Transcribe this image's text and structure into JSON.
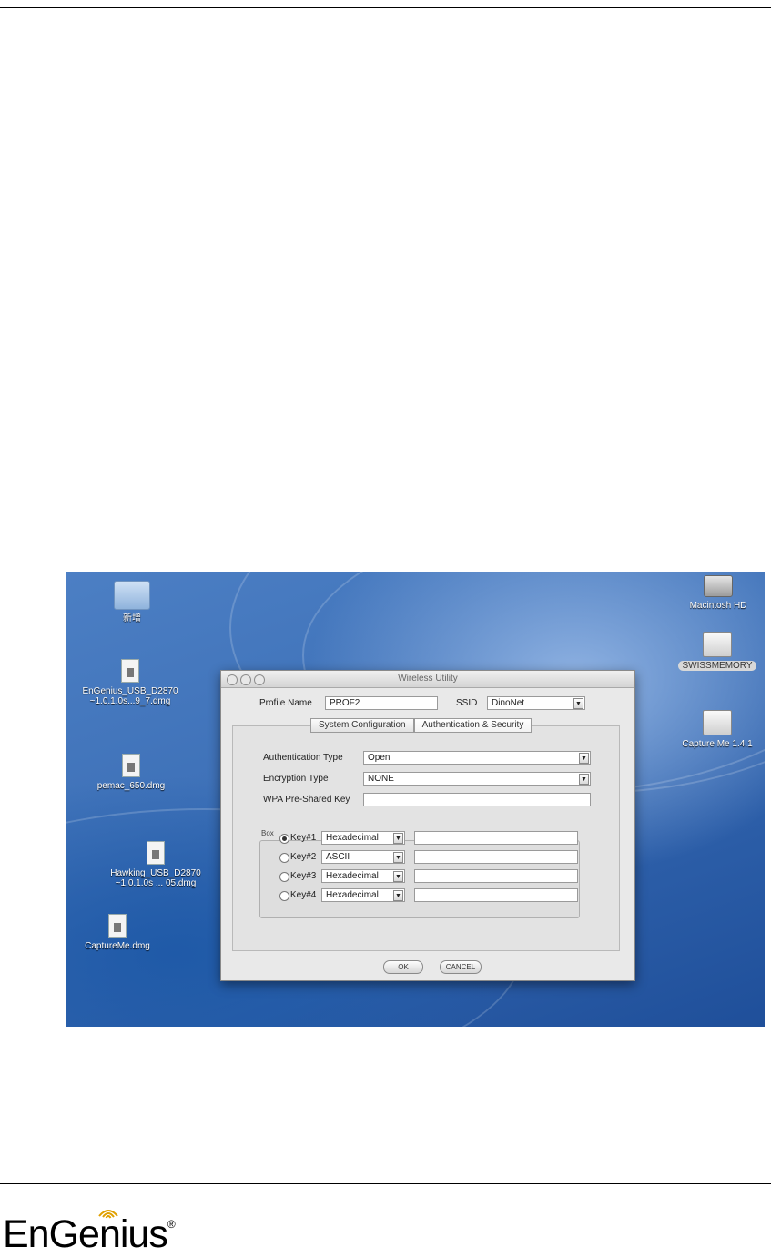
{
  "window": {
    "title": "Wireless Utility",
    "profile_name_label": "Profile Name",
    "profile_name_value": "PROF2",
    "ssid_label": "SSID",
    "ssid_value": "DinoNet",
    "tabs": [
      {
        "label": "System Configuration"
      },
      {
        "label": "Authentication & Security"
      }
    ],
    "auth_type_label": "Authentication Type",
    "auth_type_value": "Open",
    "encryption_type_label": "Encryption Type",
    "encryption_type_value": "NONE",
    "wpa_psk_label": "WPA Pre-Shared Key",
    "wpa_psk_value": "",
    "group_title": "Box",
    "keys": [
      {
        "label": "Key#1",
        "format": "Hexadecimal",
        "value": "",
        "selected": true
      },
      {
        "label": "Key#2",
        "format": "ASCII",
        "value": "",
        "selected": false
      },
      {
        "label": "Key#3",
        "format": "Hexadecimal",
        "value": "",
        "selected": false
      },
      {
        "label": "Key#4",
        "format": "Hexadecimal",
        "value": "",
        "selected": false
      }
    ],
    "ok_label": "OK",
    "cancel_label": "CANCEL"
  },
  "desktop": {
    "icons": [
      {
        "name": "folder",
        "label": "新增"
      },
      {
        "name": "dmg",
        "label": "EnGenius_USB_D2870\n~1.0.1.0s...9_7.dmg"
      },
      {
        "name": "dmg",
        "label": "pemac_650.dmg"
      },
      {
        "name": "dmg",
        "label": "Hawking_USB_D2870\n~1.0.1.0s ... 05.dmg"
      },
      {
        "name": "dmg",
        "label": "CaptureMe.dmg"
      },
      {
        "name": "hard-drive",
        "label": "Macintosh HD"
      },
      {
        "name": "usb-drive",
        "label": "SWISSMEMORY"
      },
      {
        "name": "drive",
        "label": "Capture Me 1.4.1"
      }
    ]
  },
  "footer": {
    "brand": "EnGenius",
    "reg_mark": "®"
  }
}
